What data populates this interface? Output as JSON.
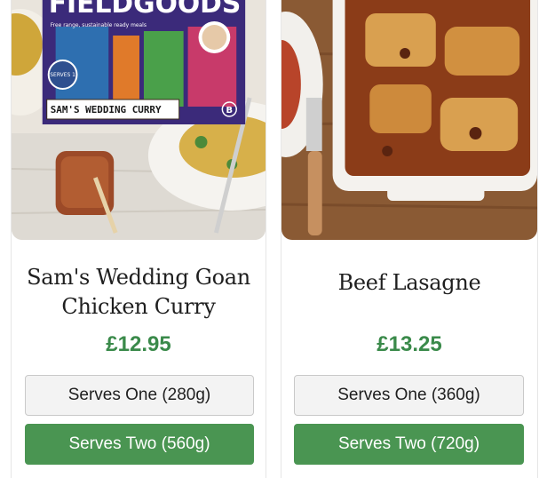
{
  "products": [
    {
      "title": "Sam's Wedding Goan Chicken Curry",
      "price": "£12.95",
      "options": [
        "Serves One (280g)",
        "Serves Two (560g)"
      ],
      "image": {
        "brand": "FIELDGOODS",
        "tagline": "Free range, sustainable ready meals",
        "badge": "SERVES 1",
        "label": "SAM'S WEDDING CURRY"
      }
    },
    {
      "title": "Beef Lasagne",
      "price": "£13.25",
      "options": [
        "Serves One (360g)",
        "Serves Two (720g)"
      ]
    }
  ],
  "colors": {
    "price_green": "#3a8a4a",
    "button_green": "#4a9552",
    "button_light": "#f3f3f3"
  }
}
